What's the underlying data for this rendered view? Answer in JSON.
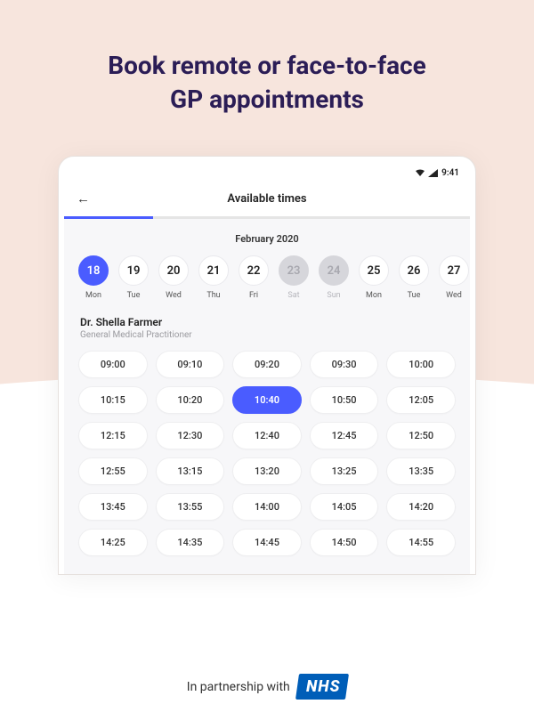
{
  "promo": {
    "title_line1": "Book remote or face-to-face",
    "title_line2": "GP appointments"
  },
  "status": {
    "time": "9:41"
  },
  "header": {
    "title": "Available times"
  },
  "calendar": {
    "month_label": "February 2020",
    "days": [
      {
        "num": "18",
        "label": "Mon",
        "state": "selected"
      },
      {
        "num": "19",
        "label": "Tue",
        "state": "default"
      },
      {
        "num": "20",
        "label": "Wed",
        "state": "default"
      },
      {
        "num": "21",
        "label": "Thu",
        "state": "default"
      },
      {
        "num": "22",
        "label": "Fri",
        "state": "default"
      },
      {
        "num": "23",
        "label": "Sat",
        "state": "disabled"
      },
      {
        "num": "24",
        "label": "Sun",
        "state": "disabled"
      },
      {
        "num": "25",
        "label": "Mon",
        "state": "default"
      },
      {
        "num": "26",
        "label": "Tue",
        "state": "default"
      },
      {
        "num": "27",
        "label": "Wed",
        "state": "default"
      }
    ]
  },
  "doctor": {
    "name": "Dr. Shella Farmer",
    "role": "General Medical Practitioner"
  },
  "slots": [
    [
      "09:00",
      "09:10",
      "09:20",
      "09:30",
      "10:00"
    ],
    [
      "10:15",
      "10:20",
      "10:40",
      "10:50",
      "12:05"
    ],
    [
      "12:15",
      "12:30",
      "12:40",
      "12:45",
      "12:50"
    ],
    [
      "12:55",
      "13:15",
      "13:20",
      "13:25",
      "13:35"
    ],
    [
      "13:45",
      "13:55",
      "14:00",
      "14:05",
      "14:20"
    ],
    [
      "14:25",
      "14:35",
      "14:45",
      "14:50",
      "14:55"
    ]
  ],
  "selected_slot": "10:40",
  "footer": {
    "text": "In partnership with",
    "nhs": "NHS"
  }
}
